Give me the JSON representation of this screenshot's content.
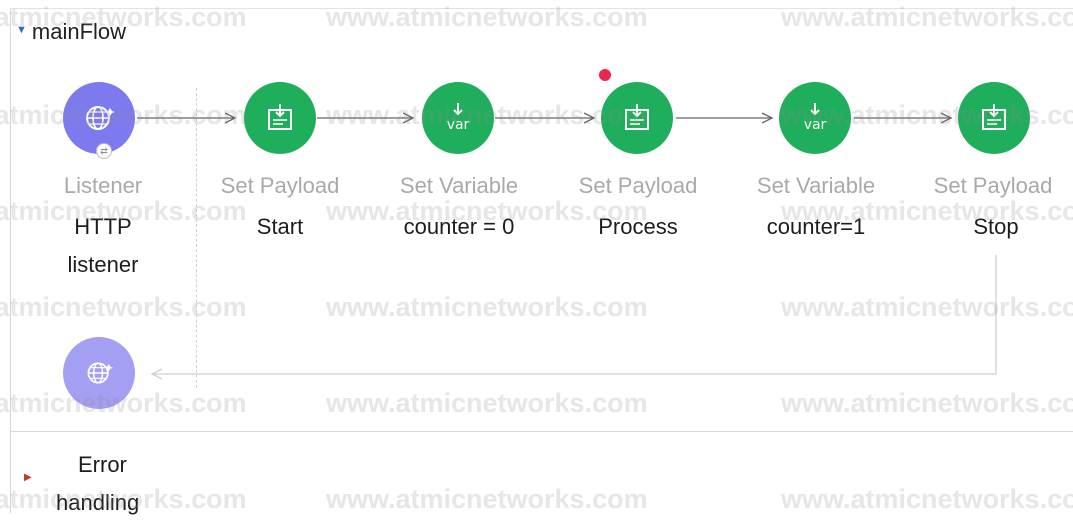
{
  "flow": {
    "name": "mainFlow"
  },
  "nodes": [
    {
      "type": "Listener",
      "name_lines": [
        "HTTP",
        "listener"
      ],
      "icon": "globe-icon",
      "color": "#7d7af0"
    },
    {
      "type": "Set Payload",
      "name_lines": [
        "Start"
      ],
      "icon": "set-payload-icon",
      "color": "#1fae5b"
    },
    {
      "type": "Set Variable",
      "name_lines": [
        "counter = 0"
      ],
      "icon": "set-variable-icon",
      "icon_text": "var",
      "color": "#1fae5b"
    },
    {
      "type": "Set Payload",
      "name_lines": [
        "Process"
      ],
      "icon": "set-payload-icon",
      "color": "#1fae5b"
    },
    {
      "type": "Set Variable",
      "name_lines": [
        "counter=1"
      ],
      "icon": "set-variable-icon",
      "icon_text": "var",
      "color": "#1fae5b"
    },
    {
      "type": "Set Payload",
      "name_lines": [
        "Stop"
      ],
      "icon": "set-payload-icon",
      "color": "#1fae5b"
    }
  ],
  "response_node": {
    "icon": "globe-icon",
    "color": "#a39ff2"
  },
  "error_handling": {
    "label_lines": [
      "Error",
      "handling"
    ]
  },
  "breakpoint": {
    "color": "#e8284f"
  },
  "watermark": "www.atmicnetworks.com",
  "colors": {
    "processor": "#1fae5b",
    "source": "#7d7af0",
    "accent": "#2c6fbf"
  }
}
